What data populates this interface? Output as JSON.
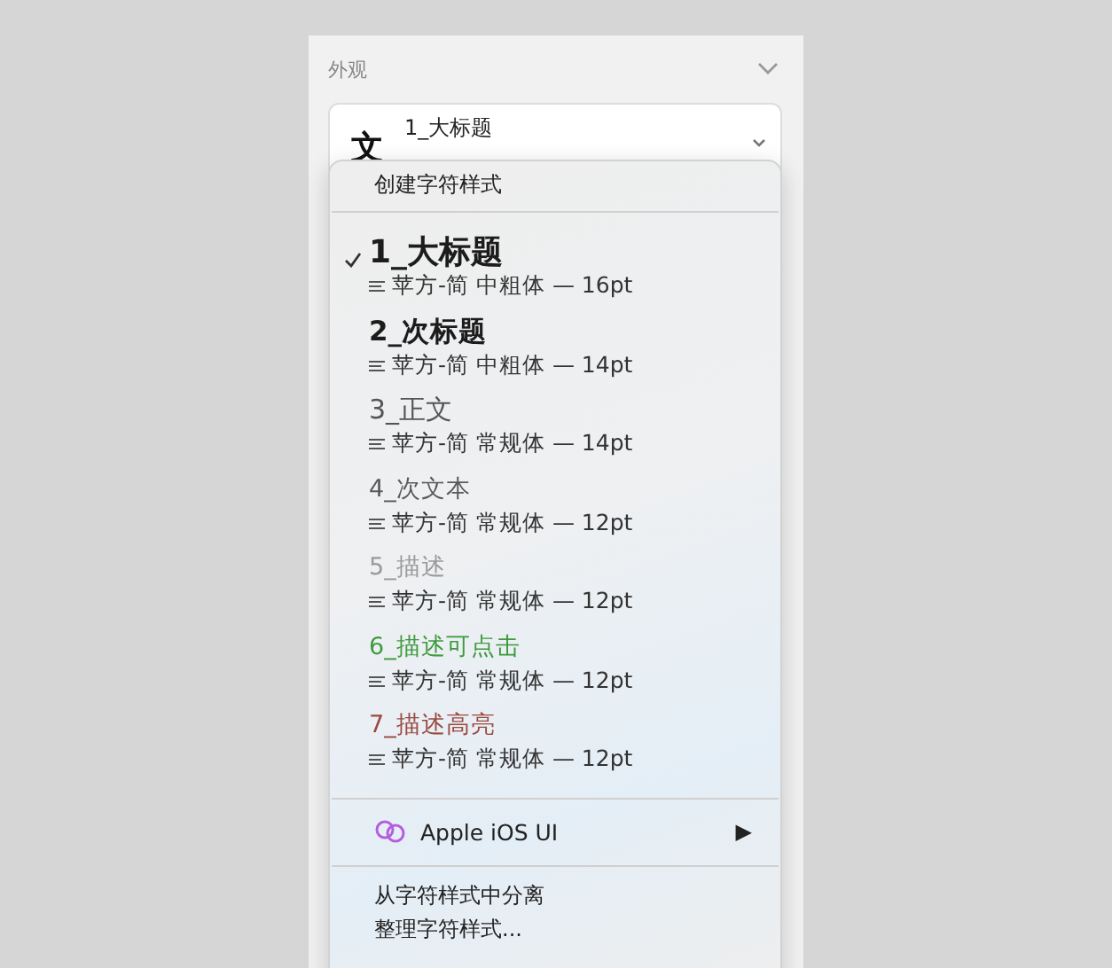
{
  "panel": {
    "section_title": "外观",
    "field": {
      "icon_glyph": "文",
      "title": "1_大标题"
    }
  },
  "menu": {
    "create_item": "创建字符样式",
    "styles": [
      {
        "name": "1_大标题",
        "detail": "苹方-简 中粗体 — 16pt",
        "kind": "h1",
        "color": "#1c1c1c",
        "selected": true
      },
      {
        "name": "2_次标题",
        "detail": "苹方-简 中粗体 — 14pt",
        "kind": "h2",
        "color": "#1c1c1c",
        "selected": false
      },
      {
        "name": "3_正文",
        "detail": "苹方-简 常规体 — 14pt",
        "kind": "h3",
        "color": "#555555",
        "selected": false
      },
      {
        "name": "4_次文本",
        "detail": "苹方-简 常规体 — 12pt",
        "kind": "body",
        "color": "#5a5a5a",
        "selected": false
      },
      {
        "name": "5_描述",
        "detail": "苹方-简 常规体 — 12pt",
        "kind": "body",
        "color": "#9a9a9a",
        "selected": false
      },
      {
        "name": "6_描述可点击",
        "detail": "苹方-简 常规体 — 12pt",
        "kind": "body",
        "color": "#3f9a3f",
        "selected": false
      },
      {
        "name": "7_描述高亮",
        "detail": "苹方-简 常规体 — 12pt",
        "kind": "body",
        "color": "#9a4a40",
        "selected": false
      }
    ],
    "library": {
      "label": "Apple iOS UI",
      "arrow": "▶"
    },
    "actions": [
      "从字符样式中分离",
      "整理字符样式..."
    ]
  }
}
